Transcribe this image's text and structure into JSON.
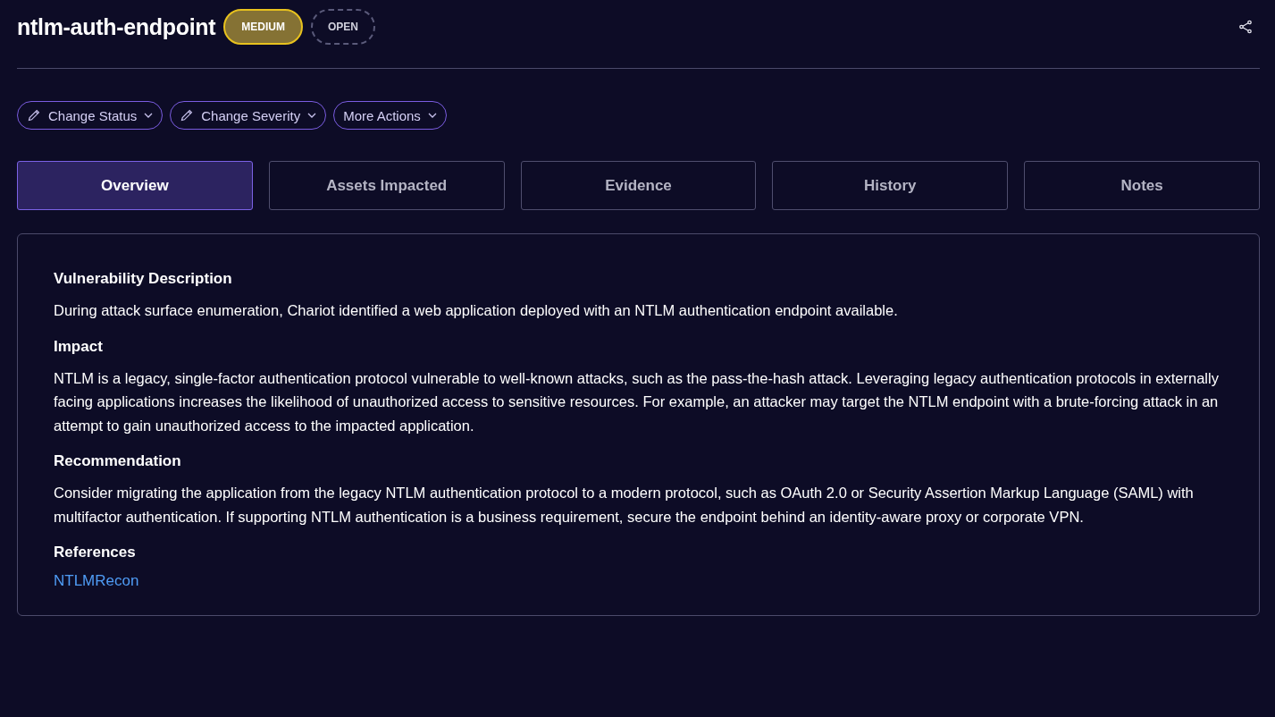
{
  "header": {
    "title": "ntlm-auth-endpoint",
    "badges": [
      {
        "kind": "severity",
        "label": "MEDIUM"
      },
      {
        "kind": "status",
        "label": "OPEN"
      }
    ]
  },
  "actions": [
    {
      "kind": "edit",
      "label": "Change Status"
    },
    {
      "kind": "edit",
      "label": "Change Severity"
    },
    {
      "kind": "plain",
      "label": "More Actions"
    }
  ],
  "tabs": [
    {
      "label": "Overview",
      "selected": true
    },
    {
      "label": "Assets Impacted",
      "selected": false
    },
    {
      "label": "Evidence",
      "selected": false
    },
    {
      "label": "History",
      "selected": false
    },
    {
      "label": "Notes",
      "selected": false
    }
  ],
  "sections": [
    {
      "kind": "text",
      "heading": "Vulnerability Description",
      "body": "During attack surface enumeration, Chariot identified a web application deployed with an NTLM authentication endpoint available."
    },
    {
      "kind": "text",
      "heading": "Impact",
      "body": "NTLM is a legacy, single-factor authentication protocol vulnerable to well-known attacks, such as the pass-the-hash attack. Leveraging legacy authentication protocols in externally facing applications increases the likelihood of unauthorized access to sensitive resources. For example, an attacker may target the NTLM endpoint with a brute-forcing attack in an attempt to gain unauthorized access to the impacted application."
    },
    {
      "kind": "text",
      "heading": "Recommendation",
      "body": "Consider migrating the application from the legacy NTLM authentication protocol to a modern protocol, such as OAuth 2.0 or Security Assertion Markup Language (SAML) with multifactor authentication. If supporting NTLM authentication is a business requirement, secure the endpoint behind an identity-aware proxy or corporate VPN."
    },
    {
      "kind": "links",
      "heading": "References",
      "links": [
        "NTLMRecon"
      ]
    }
  ]
}
